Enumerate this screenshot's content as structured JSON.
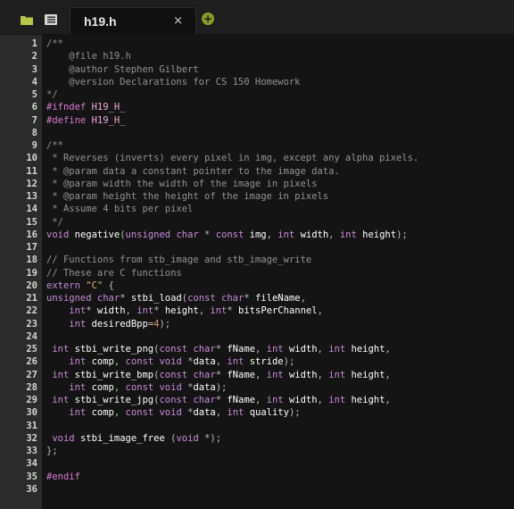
{
  "tabbar": {
    "tab_title": "h19.h",
    "close_glyph": "×",
    "new_tab_glyph": "+",
    "new_tab_color": "#8a9a2c",
    "icons": [
      "folder-icon",
      "list-icon"
    ]
  },
  "editor": {
    "lines": [
      {
        "n": "1",
        "t": "/**"
      },
      {
        "n": "2",
        "t": "    @file h19.h"
      },
      {
        "n": "3",
        "t": "    @author Stephen Gilbert"
      },
      {
        "n": "4",
        "t": "    @version Declarations for CS 150 Homework"
      },
      {
        "n": "5",
        "t": "*/"
      },
      {
        "n": "6",
        "t": "#ifndef H19_H_"
      },
      {
        "n": "7",
        "t": "#define H19_H_"
      },
      {
        "n": "8",
        "t": ""
      },
      {
        "n": "9",
        "t": "/**"
      },
      {
        "n": "10",
        "t": " * Reverses (inverts) every pixel in img, except any alpha pixels."
      },
      {
        "n": "11",
        "t": " * @param data a constant pointer to the image data."
      },
      {
        "n": "12",
        "t": " * @param width the width of the image in pixels"
      },
      {
        "n": "13",
        "t": " * @param height the height of the image in pixels"
      },
      {
        "n": "14",
        "t": " * Assume 4 bits per pixel"
      },
      {
        "n": "15",
        "t": " */"
      },
      {
        "n": "16",
        "t": "void negative(unsigned char * const img, int width, int height);"
      },
      {
        "n": "17",
        "t": ""
      },
      {
        "n": "18",
        "t": "// Functions from stb_image and stb_image_write"
      },
      {
        "n": "19",
        "t": "// These are C functions"
      },
      {
        "n": "20",
        "t": "extern \"C\" {"
      },
      {
        "n": "21",
        "t": "unsigned char* stbi_load(const char* fileName,"
      },
      {
        "n": "22",
        "t": "    int* width, int* height, int* bitsPerChannel,"
      },
      {
        "n": "23",
        "t": "    int desiredBpp=4);"
      },
      {
        "n": "24",
        "t": ""
      },
      {
        "n": "25",
        "t": " int stbi_write_png(const char* fName, int width, int height,"
      },
      {
        "n": "26",
        "t": "    int comp, const void *data, int stride);"
      },
      {
        "n": "27",
        "t": " int stbi_write_bmp(const char* fName, int width, int height,"
      },
      {
        "n": "28",
        "t": "    int comp, const void *data);"
      },
      {
        "n": "29",
        "t": " int stbi_write_jpg(const char* fName, int width, int height,"
      },
      {
        "n": "30",
        "t": "    int comp, const void *data, int quality);"
      },
      {
        "n": "31",
        "t": ""
      },
      {
        "n": "32",
        "t": " void stbi_image_free (void *);"
      },
      {
        "n": "33",
        "t": "};"
      },
      {
        "n": "34",
        "t": ""
      },
      {
        "n": "35",
        "t": "#endif"
      },
      {
        "n": "36",
        "t": ""
      }
    ]
  }
}
